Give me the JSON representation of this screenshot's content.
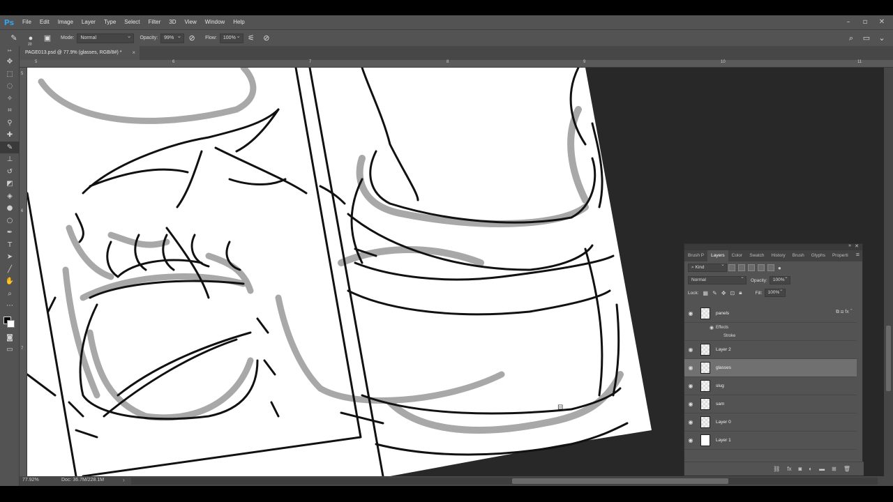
{
  "app": {
    "logo": "Ps"
  },
  "menu": [
    "File",
    "Edit",
    "Image",
    "Layer",
    "Type",
    "Select",
    "Filter",
    "3D",
    "View",
    "Window",
    "Help"
  ],
  "options": {
    "brush_size": "20",
    "mode_label": "Mode:",
    "mode_value": "Normal",
    "opacity_label": "Opacity:",
    "opacity_value": "99%",
    "flow_label": "Flow:",
    "flow_value": "100%"
  },
  "document_tab": {
    "title": "PAGE013.psd @ 77.9% (glasses, RGB/8#) *",
    "close": "×"
  },
  "ruler": {
    "h_labels": [
      "5",
      "6",
      "7",
      "8",
      "9",
      "10",
      "11"
    ],
    "v_labels": [
      "5",
      "6",
      "7"
    ]
  },
  "status": {
    "zoom": "77.92%",
    "doc": "Doc: 36.7M/228.1M",
    "arrow": "›"
  },
  "layers_panel": {
    "tabs": [
      "Brush P",
      "Layers",
      "Color",
      "Swatch",
      "History",
      "Brush",
      "Glyphs",
      "Properti"
    ],
    "active_tab": "Layers",
    "kind_label": "Kind",
    "blend_mode": "Normal",
    "opacity_label": "Opacity:",
    "opacity_value": "100%",
    "lock_label": "Lock:",
    "fill_label": "Fill:",
    "fill_value": "100%",
    "effects_label": "Effects",
    "stroke_label": "Stroke",
    "layers": [
      {
        "name": "panels",
        "selected": false,
        "has_fx": true
      },
      {
        "name": "Layer 2",
        "selected": false
      },
      {
        "name": "glasses",
        "selected": true
      },
      {
        "name": "slug",
        "selected": false
      },
      {
        "name": "sam",
        "selected": false
      },
      {
        "name": "Layer 0",
        "selected": false
      },
      {
        "name": "Layer 1",
        "selected": false,
        "solid": true
      }
    ]
  }
}
